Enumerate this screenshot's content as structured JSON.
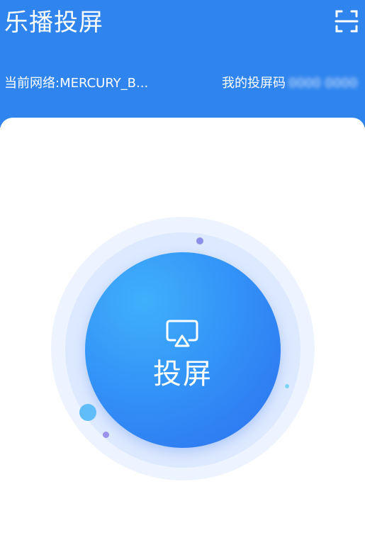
{
  "header": {
    "title": "乐播投屏",
    "network_label": "当前网络:MERCURY_B...",
    "cast_code_label": "我的投屏码",
    "cast_code_value": "0000 0000",
    "scan_icon": "scan-icon"
  },
  "main": {
    "cast_button_label": "投屏",
    "cast_icon": "airplay-icon"
  },
  "colors": {
    "brand_blue": "#2f84ee",
    "button_gradient_light": "#3fb0fb",
    "button_gradient_dark": "#2c6fef",
    "halo": "#eef4ff"
  }
}
